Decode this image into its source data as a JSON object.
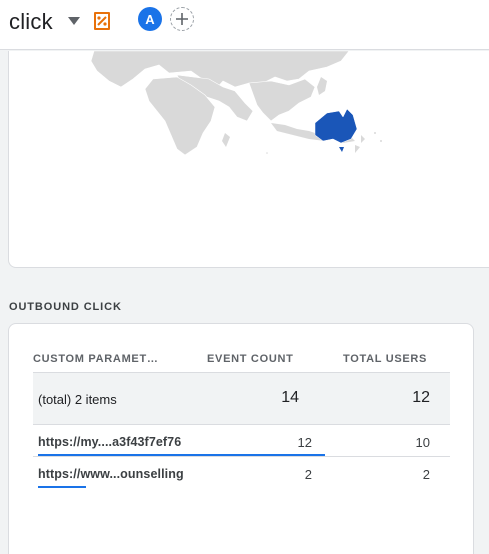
{
  "header": {
    "title": "click",
    "comparison_avatar": "A"
  },
  "colors": {
    "accent": "#1a73e8",
    "map_highlight": "#1a56b8",
    "map_land": "#d9d9d9",
    "report_icon": "#e8710a"
  },
  "map": {
    "highlighted_region": "Australia"
  },
  "outbound": {
    "section_title": "OUTBOUND CLICK",
    "columns": {
      "param": "CUSTOM PARAMET…",
      "events": "EVENT COUNT",
      "users": "TOTAL USERS"
    },
    "total": {
      "label": "(total) 2 items",
      "events": "14",
      "users": "12"
    },
    "rows": [
      {
        "label": "https://my....a3f43f7ef76",
        "events": "12",
        "users": "10",
        "share": 0.857
      },
      {
        "label": "https://www...ounselling",
        "events": "2",
        "users": "2",
        "share": 0.143
      }
    ]
  }
}
